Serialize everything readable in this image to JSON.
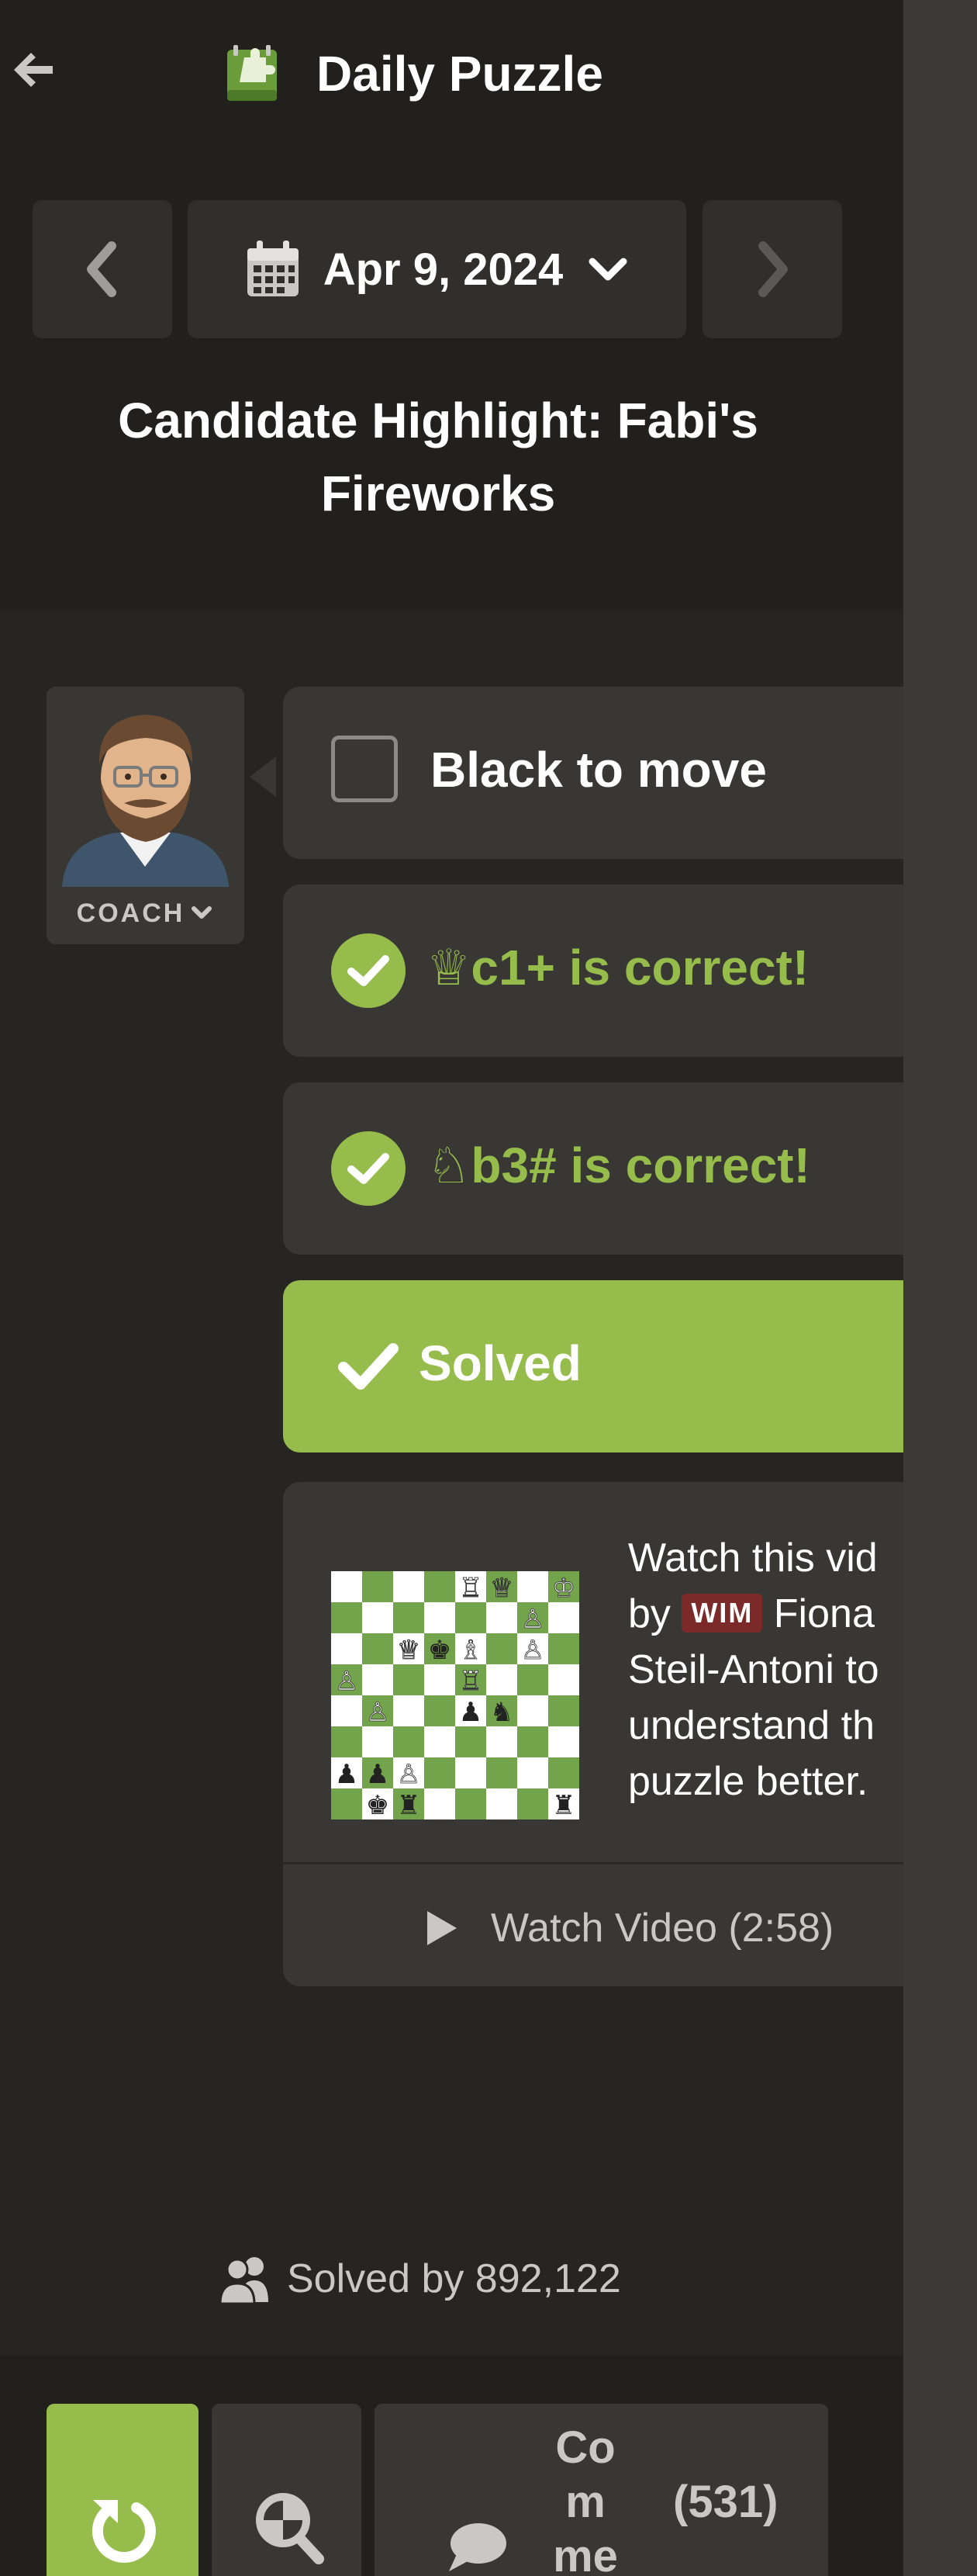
{
  "header": {
    "title": "Daily Puzzle",
    "date": "Apr 9, 2024",
    "puzzle_title": "Candidate Highlight: Fabi's Fireworks"
  },
  "coach": {
    "label": "COACH"
  },
  "messages": {
    "to_move": "Black to move",
    "move1_piece": "♕",
    "move1_text": "c1+ is correct!",
    "move2_piece": "♘",
    "move2_text": "b3# is correct!",
    "solved": "Solved"
  },
  "video": {
    "line1": "Watch this vid",
    "line2_prefix": "by",
    "badge": "WIM",
    "line2_suffix": "Fiona",
    "line3": "Steil-Antoni to",
    "line4": "understand th",
    "line5": "puzzle better.",
    "watch_label": "Watch Video (2:58)"
  },
  "stats": {
    "solved_by": "Solved by 892,122"
  },
  "bottom": {
    "comment_label": "Comment",
    "comment_count": "(531)"
  },
  "colors": {
    "accent_green": "#96bc4b",
    "panel_bg": "#262522",
    "card_bg": "#383734",
    "wim_badge": "#7c2929"
  },
  "board": [
    "    RQ K",
    "      P ",
    "  QkB P ",
    "P   R   ",
    " P  pn  ",
    "        ",
    "ppP     ",
    " kr    r"
  ]
}
